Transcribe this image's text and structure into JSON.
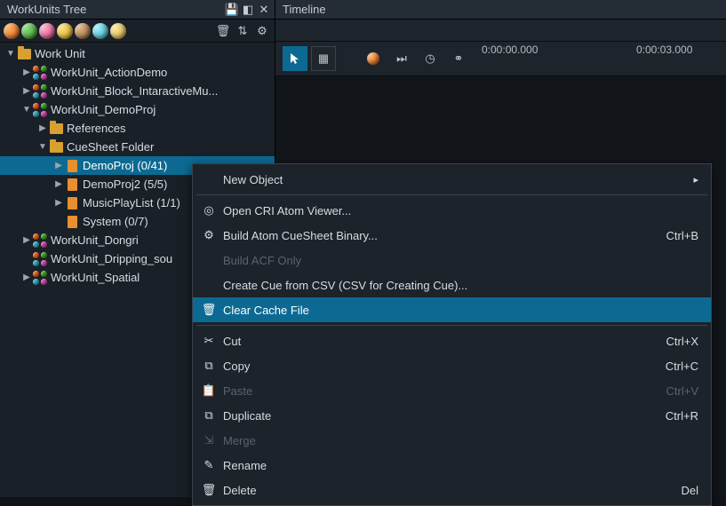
{
  "left_panel": {
    "title": "WorkUnits Tree",
    "tree": [
      {
        "indent": 0,
        "arrow": "down",
        "icon": "folder",
        "label": "Work Unit"
      },
      {
        "indent": 1,
        "arrow": "right",
        "icon": "wu",
        "label": "WorkUnit_ActionDemo"
      },
      {
        "indent": 1,
        "arrow": "right",
        "icon": "wu",
        "label": "WorkUnit_Block_IntaractiveMu..."
      },
      {
        "indent": 1,
        "arrow": "down",
        "icon": "wu",
        "label": "WorkUnit_DemoProj"
      },
      {
        "indent": 2,
        "arrow": "right",
        "icon": "folder",
        "label": "References"
      },
      {
        "indent": 2,
        "arrow": "down",
        "icon": "folder",
        "label": "CueSheet Folder"
      },
      {
        "indent": 3,
        "arrow": "right",
        "icon": "file",
        "label": "DemoProj (0/41)",
        "selected": true
      },
      {
        "indent": 3,
        "arrow": "right",
        "icon": "file",
        "label": "DemoProj2 (5/5)"
      },
      {
        "indent": 3,
        "arrow": "right",
        "icon": "file",
        "label": "MusicPlayList (1/1)"
      },
      {
        "indent": 3,
        "arrow": "none",
        "icon": "file",
        "label": "System (0/7)"
      },
      {
        "indent": 1,
        "arrow": "right",
        "icon": "wu",
        "label": "WorkUnit_Dongri"
      },
      {
        "indent": 1,
        "arrow": "none",
        "icon": "wu",
        "label": "WorkUnit_Dripping_sou"
      },
      {
        "indent": 1,
        "arrow": "right",
        "icon": "wu",
        "label": "WorkUnit_Spatial"
      }
    ]
  },
  "right_panel": {
    "title": "Timeline",
    "ruler": {
      "start": "0:00:00.000",
      "mid": "0:00:03.000"
    }
  },
  "context_menu": {
    "items": [
      {
        "icon": "",
        "label": "New Object",
        "shortcut": "",
        "type": "submenu"
      },
      {
        "type": "sep"
      },
      {
        "icon": "◎",
        "label": "Open CRI Atom Viewer...",
        "shortcut": ""
      },
      {
        "icon": "⚙",
        "label": "Build Atom CueSheet Binary...",
        "shortcut": "Ctrl+B"
      },
      {
        "icon": "",
        "label": "Build ACF Only",
        "shortcut": "",
        "disabled": true
      },
      {
        "icon": "",
        "label": "Create Cue from CSV (CSV for Creating Cue)...",
        "shortcut": ""
      },
      {
        "icon": "🗑",
        "label": "Clear Cache File",
        "shortcut": "",
        "highlight": true
      },
      {
        "type": "sep"
      },
      {
        "icon": "✂",
        "label": "Cut",
        "shortcut": "Ctrl+X"
      },
      {
        "icon": "⧉",
        "label": "Copy",
        "shortcut": "Ctrl+C"
      },
      {
        "icon": "📋",
        "label": "Paste",
        "shortcut": "Ctrl+V",
        "disabled": true
      },
      {
        "icon": "⧉",
        "label": "Duplicate",
        "shortcut": "Ctrl+R"
      },
      {
        "icon": "⇲",
        "label": "Merge",
        "shortcut": "",
        "disabled": true
      },
      {
        "icon": "✎",
        "label": "Rename",
        "shortcut": ""
      },
      {
        "icon": "🗑",
        "label": "Delete",
        "shortcut": "Del"
      }
    ]
  }
}
